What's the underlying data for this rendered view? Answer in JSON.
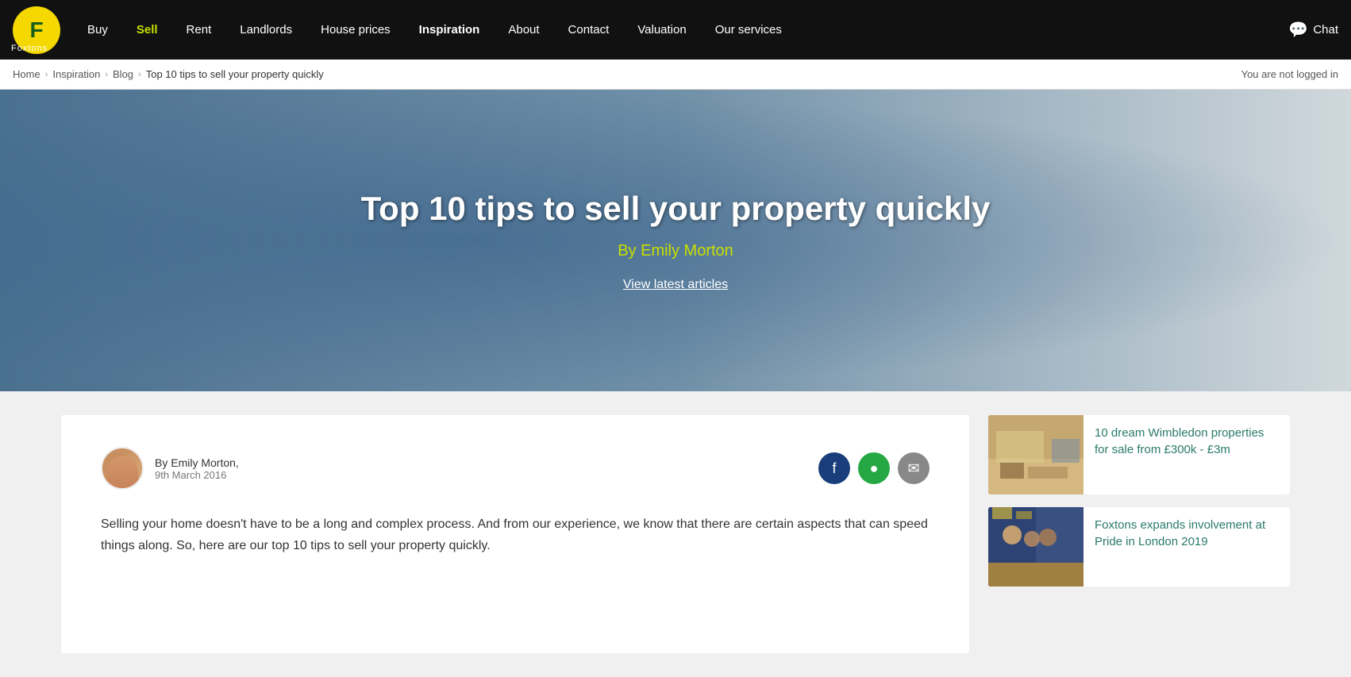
{
  "nav": {
    "logo_letter": "F",
    "logo_label": "Foxtons",
    "links": [
      {
        "label": "Buy",
        "active": false,
        "sell": false,
        "inspiration": false
      },
      {
        "label": "Sell",
        "active": false,
        "sell": true,
        "inspiration": false
      },
      {
        "label": "Rent",
        "active": false,
        "sell": false,
        "inspiration": false
      },
      {
        "label": "Landlords",
        "active": false,
        "sell": false,
        "inspiration": false
      },
      {
        "label": "House prices",
        "active": false,
        "sell": false,
        "inspiration": false
      },
      {
        "label": "Inspiration",
        "active": true,
        "sell": false,
        "inspiration": true
      },
      {
        "label": "About",
        "active": false,
        "sell": false,
        "inspiration": false
      },
      {
        "label": "Contact",
        "active": false,
        "sell": false,
        "inspiration": false
      },
      {
        "label": "Valuation",
        "active": false,
        "sell": false,
        "inspiration": false
      },
      {
        "label": "Our services",
        "active": false,
        "sell": false,
        "inspiration": false
      }
    ],
    "chat_label": "Chat"
  },
  "breadcrumb": {
    "home": "Home",
    "inspiration": "Inspiration",
    "blog": "Blog",
    "current": "Top 10 tips to sell your property quickly",
    "not_logged": "You are not logged in"
  },
  "hero": {
    "title": "Top 10 tips to sell your property quickly",
    "author": "By Emily Morton",
    "link_label": "View latest articles"
  },
  "article": {
    "author_name": "By Emily Morton,",
    "date": "9th March 2016",
    "body": "Selling your home doesn't have to be a long and complex process. And from our experience, we know that there are certain aspects that can speed things along. So, here are our top 10 tips to sell your property quickly."
  },
  "sidebar": {
    "cards": [
      {
        "title": "10 dream Wimbledon properties for sale from £300k - £3m",
        "img_type": "wimbledon"
      },
      {
        "title": "Foxtons expands involvement at Pride in London 2019",
        "img_type": "pride"
      }
    ]
  }
}
